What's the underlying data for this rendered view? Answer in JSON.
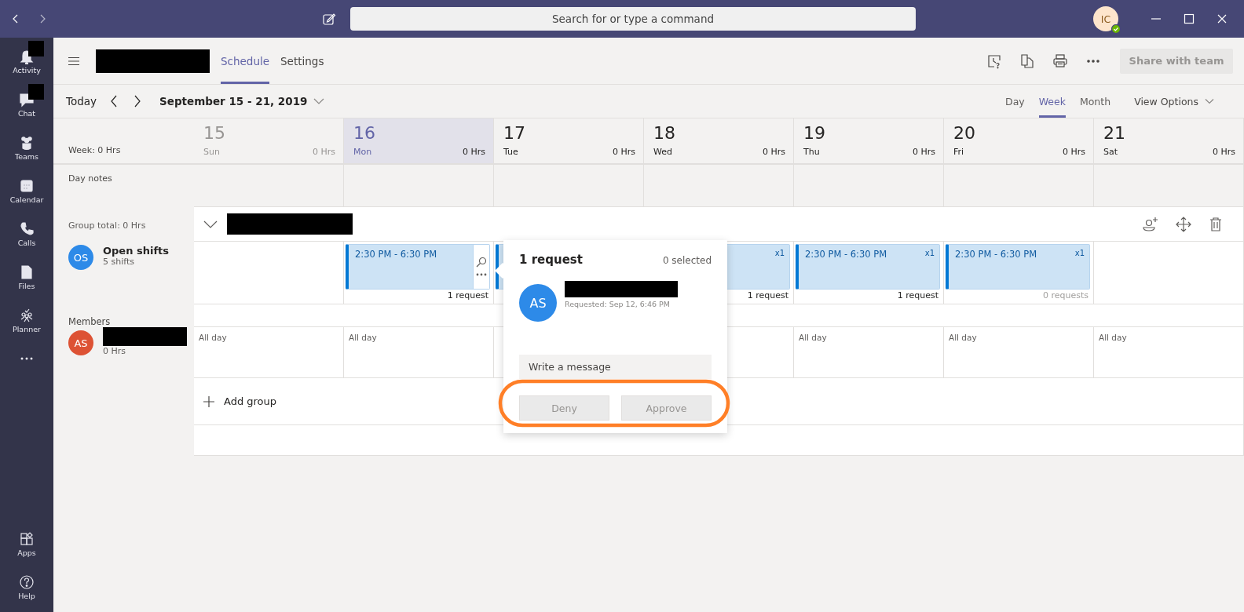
{
  "title_bar": {
    "search_placeholder": "Search for or type a command",
    "avatar": "IC"
  },
  "rail": {
    "top": [
      {
        "label": "Activity",
        "redacted": true
      },
      {
        "label": "Chat",
        "redacted": true
      },
      {
        "label": "Teams",
        "redacted": false
      },
      {
        "label": "Calendar",
        "redacted": false
      },
      {
        "label": "Calls",
        "redacted": false
      },
      {
        "label": "Files",
        "redacted": false
      },
      {
        "label": "Planner",
        "redacted": false
      }
    ],
    "bottom": [
      {
        "label": "Apps"
      },
      {
        "label": "Help"
      }
    ]
  },
  "header": {
    "tabs": [
      {
        "label": "Schedule",
        "selected": true
      },
      {
        "label": "Settings",
        "selected": false
      }
    ],
    "share_button": {
      "label": "Share with team",
      "disabled": true
    }
  },
  "toolbar": {
    "today": "Today",
    "date_range": "September 15 - 21, 2019",
    "views": [
      {
        "label": "Day",
        "selected": false
      },
      {
        "label": "Week",
        "selected": true
      },
      {
        "label": "Month",
        "selected": false
      }
    ],
    "view_options": "View Options"
  },
  "week": {
    "total": "Week: 0 Hrs",
    "days": [
      {
        "number": "15",
        "name": "Sun",
        "hours": "0 Hrs",
        "selected": false,
        "past": true
      },
      {
        "number": "16",
        "name": "Mon",
        "hours": "0 Hrs",
        "selected": true,
        "past": false
      },
      {
        "number": "17",
        "name": "Tue",
        "hours": "0 Hrs",
        "selected": false,
        "past": false
      },
      {
        "number": "18",
        "name": "Wed",
        "hours": "0 Hrs",
        "selected": false,
        "past": false
      },
      {
        "number": "19",
        "name": "Thu",
        "hours": "0 Hrs",
        "selected": false,
        "past": false
      },
      {
        "number": "20",
        "name": "Fri",
        "hours": "0 Hrs",
        "selected": false,
        "past": false
      },
      {
        "number": "21",
        "name": "Sat",
        "hours": "0 Hrs",
        "selected": false,
        "past": false
      }
    ],
    "day_notes": "Day notes"
  },
  "group": {
    "total": "Group total: 0 Hrs",
    "open_shifts": {
      "initials": "OS",
      "title": "Open shifts",
      "subtitle": "5 shifts",
      "color": "#2d8ae8"
    },
    "shift_cells": [
      {
        "kind": "empty"
      },
      {
        "kind": "shift",
        "time": "2:30 PM - 6:30 PM",
        "actions": true,
        "requests": "1 request",
        "requests_muted": false
      },
      {
        "kind": "shift"
      },
      {
        "kind": "shift",
        "count": "x1",
        "actions": false,
        "requests": "1 request",
        "requests_muted": false
      },
      {
        "kind": "shift",
        "time": "2:30 PM - 6:30 PM",
        "count": "x1",
        "actions": false,
        "requests": "1 request",
        "requests_muted": false
      },
      {
        "kind": "shift",
        "time": "2:30 PM - 6:30 PM",
        "count": "x1",
        "actions": false,
        "requests": "0 requests",
        "requests_muted": true
      },
      {
        "kind": "empty"
      }
    ],
    "members_label": "Members",
    "member": {
      "initials": "AS",
      "hours": "0 Hrs",
      "color": "#dd5234"
    },
    "member_cells": [
      {
        "kind": "allday",
        "label": "All day"
      },
      {
        "kind": "allday",
        "label": "All day"
      },
      {
        "kind": "empty"
      },
      {
        "kind": "empty"
      },
      {
        "kind": "allday",
        "label": "All day"
      },
      {
        "kind": "allday",
        "label": "All day"
      },
      {
        "kind": "allday",
        "label": "All day"
      }
    ],
    "add_group": "Add group"
  },
  "popup": {
    "title": "1 request",
    "selected_count": "0 selected",
    "requester": {
      "initials": "AS",
      "color": "#2d8ae8",
      "requested": "Requested: Sep 12, 6:46 PM"
    },
    "message_placeholder": "Write a message",
    "buttons": [
      {
        "label": "Deny",
        "disabled": true
      },
      {
        "label": "Approve",
        "disabled": true
      }
    ]
  }
}
